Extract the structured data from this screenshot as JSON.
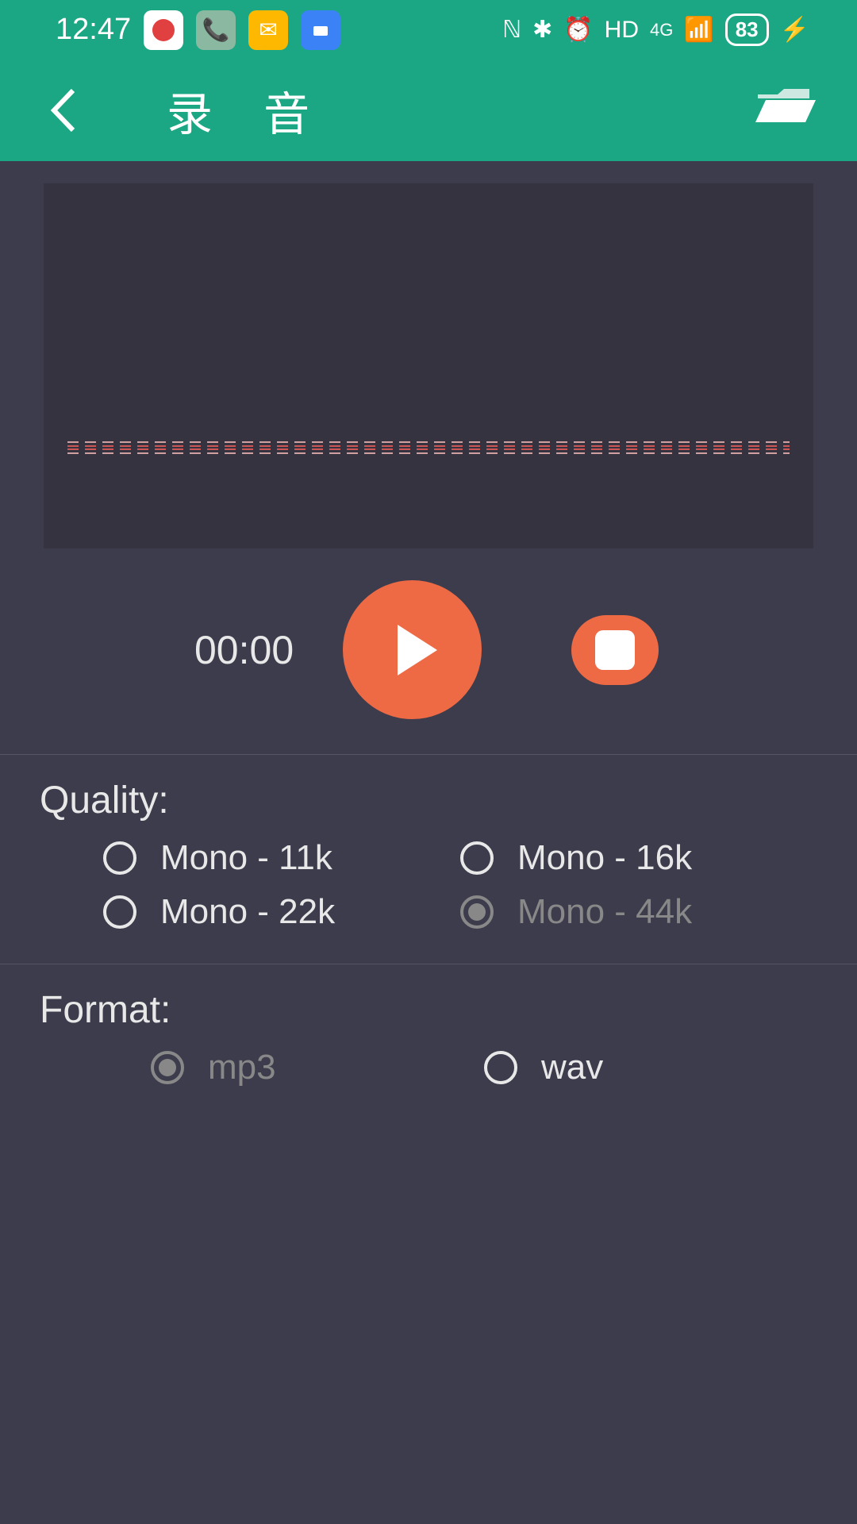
{
  "status_bar": {
    "time": "12:47",
    "hd": "HD",
    "network": "4G",
    "battery": "83"
  },
  "header": {
    "title": "录 音"
  },
  "player": {
    "time": "00:00"
  },
  "quality": {
    "label": "Quality:",
    "options": [
      {
        "label": "Mono - 11k",
        "selected": false
      },
      {
        "label": "Mono - 16k",
        "selected": false
      },
      {
        "label": "Mono - 22k",
        "selected": false
      },
      {
        "label": "Mono -  44k",
        "selected": true
      }
    ]
  },
  "format": {
    "label": "Format:",
    "options": [
      {
        "label": "mp3",
        "selected": true
      },
      {
        "label": "wav",
        "selected": false
      }
    ]
  }
}
